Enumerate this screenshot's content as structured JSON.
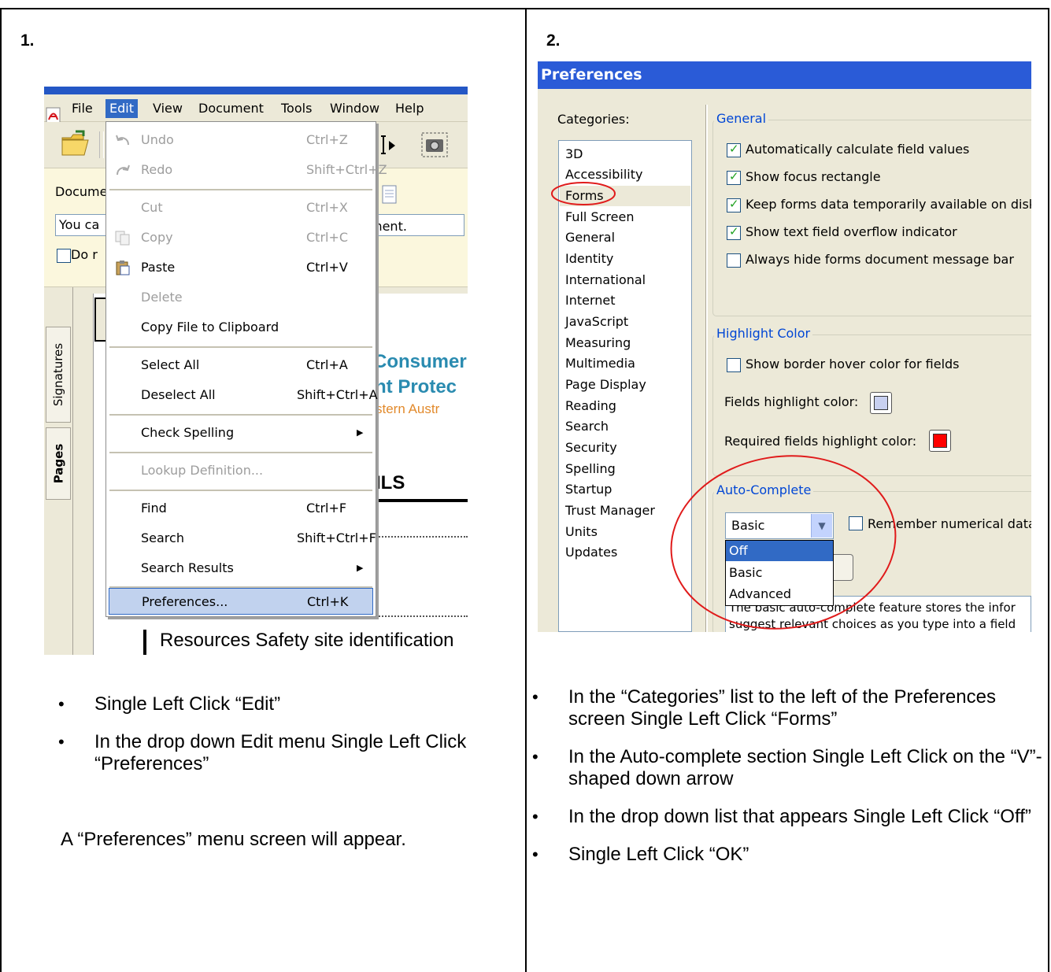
{
  "steps": [
    {
      "number": "1.",
      "bullets": [
        "Single Left Click “Edit”",
        "In the drop down Edit menu Single Left Click “Preferences”"
      ],
      "note": "A “Preferences” menu screen will appear."
    },
    {
      "number": "2.",
      "bullets": [
        "In the “Categories” list to the left of the Preferences screen Single Left Click “Forms”",
        "In the Auto-complete section Single Left Click on the “V”-shaped down arrow",
        "In the drop down list that appears Single Left Click “Off”",
        "Single Left Click “OK”"
      ]
    }
  ],
  "acrobat": {
    "menubar": [
      "File",
      "Edit",
      "View",
      "Document",
      "Tools",
      "Window",
      "Help"
    ],
    "docbar": {
      "label": "Docume",
      "input_left": "You ca",
      "input_right": "ment.",
      "checkbox_label": "Do r"
    },
    "side_tabs": [
      "Signatures",
      "Pages"
    ],
    "page_text": {
      "consumer": "Consumer",
      "protect": "nt Protec",
      "region": "stern Austr",
      "heading": "ILS",
      "footer": "Resources Safety site identification"
    },
    "edit_menu": [
      {
        "label": "Undo",
        "shortcut": "Ctrl+Z",
        "disabled": true,
        "icon": "undo-icon"
      },
      {
        "label": "Redo",
        "shortcut": "Shift+Ctrl+Z",
        "disabled": true,
        "icon": "redo-icon"
      },
      {
        "label": "Cut",
        "shortcut": "Ctrl+X",
        "disabled": true
      },
      {
        "label": "Copy",
        "shortcut": "Ctrl+C",
        "disabled": true,
        "icon": "copy-icon"
      },
      {
        "label": "Paste",
        "shortcut": "Ctrl+V",
        "disabled": false,
        "icon": "paste-icon"
      },
      {
        "label": "Delete",
        "shortcut": "",
        "disabled": true
      },
      {
        "label": "Copy File to Clipboard",
        "shortcut": "",
        "disabled": false
      },
      {
        "label": "Select All",
        "shortcut": "Ctrl+A",
        "disabled": false
      },
      {
        "label": "Deselect All",
        "shortcut": "Shift+Ctrl+A",
        "disabled": false
      },
      {
        "label": "Check Spelling",
        "shortcut": "",
        "disabled": false,
        "submenu": true
      },
      {
        "label": "Lookup Definition...",
        "shortcut": "",
        "disabled": true
      },
      {
        "label": "Find",
        "shortcut": "Ctrl+F",
        "disabled": false
      },
      {
        "label": "Search",
        "shortcut": "Shift+Ctrl+F",
        "disabled": false
      },
      {
        "label": "Search Results",
        "shortcut": "",
        "disabled": false,
        "submenu": true
      },
      {
        "label": "Preferences...",
        "shortcut": "Ctrl+K",
        "disabled": false,
        "highlighted": true
      }
    ]
  },
  "preferences": {
    "title": "Preferences",
    "categories_label": "Categories:",
    "categories": [
      "3D",
      "Accessibility",
      "Forms",
      "Full Screen",
      "General",
      "Identity",
      "International",
      "Internet",
      "JavaScript",
      "Measuring",
      "Multimedia",
      "Page Display",
      "Reading",
      "Search",
      "Security",
      "Spelling",
      "Startup",
      "Trust Manager",
      "Units",
      "Updates"
    ],
    "selected_category": "Forms",
    "general": {
      "title": "General",
      "options": [
        {
          "label": "Automatically calculate field values",
          "checked": true
        },
        {
          "label": "Show focus rectangle",
          "checked": true
        },
        {
          "label": "Keep forms data temporarily available on disk",
          "checked": true
        },
        {
          "label": "Show text field overflow indicator",
          "checked": true
        },
        {
          "label": "Always hide forms document message bar",
          "checked": false
        }
      ]
    },
    "highlight": {
      "title": "Highlight Color",
      "hover_label": "Show border hover color for fields",
      "hover_checked": false,
      "fields_label": "Fields highlight color:",
      "fields_color": "#c8d0f0",
      "required_label": "Required fields highlight color:",
      "required_color": "#ff0000"
    },
    "autocomplete": {
      "title": "Auto-Complete",
      "value": "Basic",
      "options": [
        "Off",
        "Basic",
        "Advanced"
      ],
      "highlighted_option": "Off",
      "remember_label": "Remember numerical data",
      "description_line1": "The basic auto-complete feature stores the infor",
      "description_line2": "suggest relevant choices as you type into a field"
    }
  },
  "colors": {
    "annotation_circle": "#e01b1b",
    "menu_highlight": "#316ac5",
    "group_title": "#0046d5"
  }
}
